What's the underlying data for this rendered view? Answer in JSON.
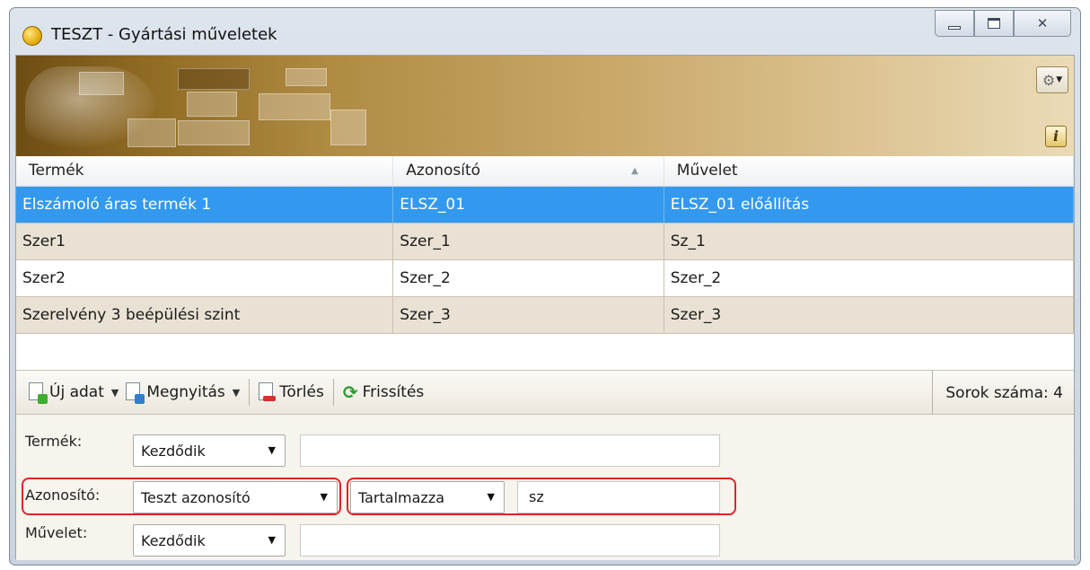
{
  "window": {
    "title": "TESZT - Gyártási műveletek"
  },
  "banner": {
    "settings_icon": "gear-icon",
    "info_label": "i"
  },
  "grid": {
    "columns": [
      "Termék",
      "Azonosító",
      "Művelet"
    ],
    "sorted_column": "Azonosító",
    "sort_direction": "ascending",
    "rows": [
      [
        "Elszámoló áras termék 1",
        "ELSZ_01",
        "ELSZ_01 előállítás"
      ],
      [
        "Szer1",
        "Szer_1",
        "Sz_1"
      ],
      [
        "Szer2",
        "Szer_2",
        "Szer_2"
      ],
      [
        "Szerelvény 3 beépülési szint",
        "Szer_3",
        "Szer_3"
      ]
    ],
    "selected_row": 0,
    "colors": {
      "selected": "#3399ef",
      "alt_row": "#e9e2d4"
    }
  },
  "toolbar": {
    "new_label": "Új adat",
    "open_label": "Megnyitás",
    "delete_label": "Törlés",
    "refresh_label": "Frissítés",
    "row_count_label": "Sorok száma:",
    "row_count": "4"
  },
  "filters": {
    "product": {
      "label": "Termék:",
      "mode": "Kezdődik",
      "value": ""
    },
    "identifier": {
      "label": "Azonosító:",
      "field": "Teszt azonosító",
      "mode": "Tartalmazza",
      "value": "sz"
    },
    "operation": {
      "label": "Művelet:",
      "mode": "Kezdődik",
      "value": ""
    },
    "highlight_color": "#e02424"
  }
}
